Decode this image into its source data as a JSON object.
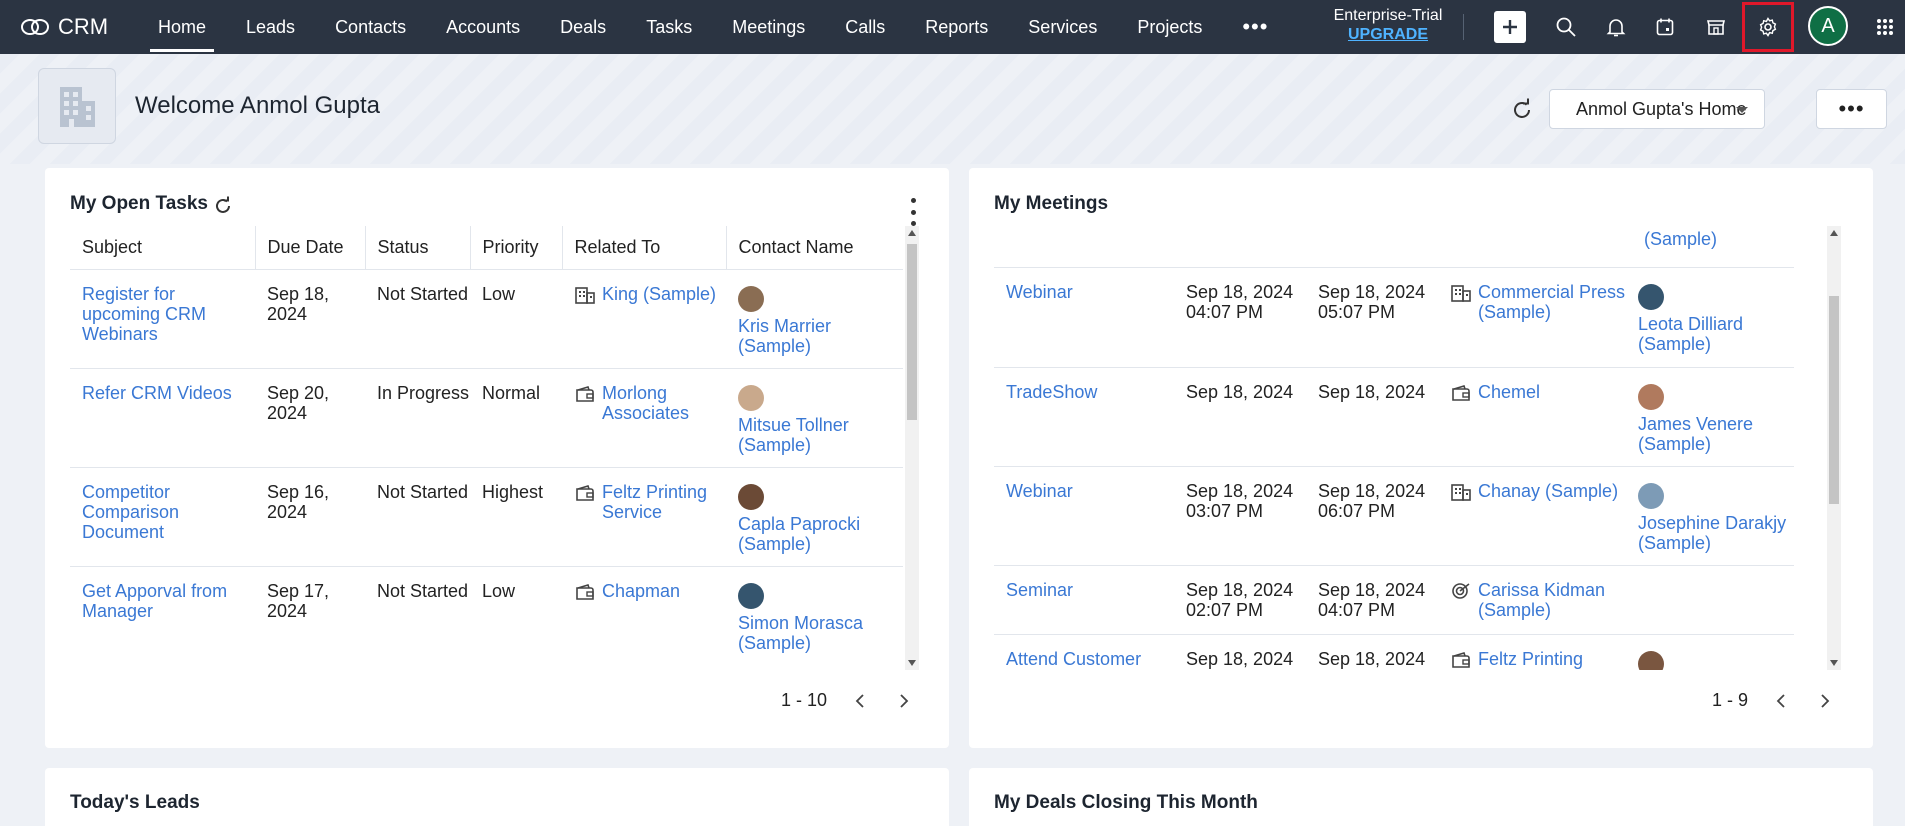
{
  "app": {
    "logo_text": "CRM"
  },
  "nav": {
    "items": [
      "Home",
      "Leads",
      "Contacts",
      "Accounts",
      "Deals",
      "Tasks",
      "Meetings",
      "Calls",
      "Reports",
      "Services",
      "Projects"
    ],
    "active": "Home",
    "more_label": "•••"
  },
  "trial": {
    "edition": "Enterprise-Trial",
    "upgrade": "UPGRADE"
  },
  "user": {
    "avatar_initial": "A"
  },
  "header": {
    "welcome": "Welcome Anmol Gupta",
    "home_select": "Anmol Gupta's Home",
    "more_label": "•••"
  },
  "tasks": {
    "title": "My Open Tasks",
    "columns": [
      "Subject",
      "Due Date",
      "Status",
      "Priority",
      "Related To",
      "Contact Name"
    ],
    "rows": [
      {
        "subject": "Register for upcoming CRM Webinars",
        "due": "Sep 18, 2024",
        "status": "Not Started",
        "priority": "Low",
        "related": "King (Sample)",
        "related_icon": "account-icon",
        "contact": "Kris Marrier (Sample)"
      },
      {
        "subject": "Refer CRM Videos",
        "due": "Sep 20, 2024",
        "status": "In Progress",
        "priority": "Normal",
        "related": "Morlong Associates",
        "related_icon": "deal-icon",
        "contact": "Mitsue Tollner (Sample)"
      },
      {
        "subject": "Competitor Comparison Document",
        "due": "Sep 16, 2024",
        "status": "Not Started",
        "priority": "Highest",
        "related": "Feltz Printing Service",
        "related_icon": "deal-icon",
        "contact": "Capla Paprocki (Sample)"
      },
      {
        "subject": "Get Apporval from Manager",
        "due": "Sep 17, 2024",
        "status": "Not Started",
        "priority": "Low",
        "related": "Chapman",
        "related_icon": "deal-icon",
        "contact": "Simon Morasca (Sample)"
      }
    ],
    "pager": "1 - 10"
  },
  "meetings": {
    "title": "My Meetings",
    "top_partial": "(Sample)",
    "rows": [
      {
        "title": "Webinar",
        "from": "Sep 18, 2024 04:07 PM",
        "to": "Sep 18, 2024 05:07 PM",
        "related": "Commercial Press (Sample)",
        "related_icon": "account-icon",
        "contact": "Leota Dilliard (Sample)"
      },
      {
        "title": "TradeShow",
        "from": "Sep 18, 2024",
        "to": "Sep 18, 2024",
        "related": "Chemel",
        "related_icon": "deal-icon",
        "contact": "James Venere (Sample)"
      },
      {
        "title": "Webinar",
        "from": "Sep 18, 2024 03:07 PM",
        "to": "Sep 18, 2024 06:07 PM",
        "related": "Chanay (Sample)",
        "related_icon": "account-icon",
        "contact": "Josephine Darakjy (Sample)"
      },
      {
        "title": "Seminar",
        "from": "Sep 18, 2024 02:07 PM",
        "to": "Sep 18, 2024 04:07 PM",
        "related": "Carissa Kidman (Sample)",
        "related_icon": "lead-icon",
        "contact": ""
      },
      {
        "title": "Attend Customer conference",
        "from": "Sep 18, 2024",
        "to": "Sep 18, 2024",
        "related": "Feltz Printing Service",
        "related_icon": "deal-icon",
        "contact": ""
      }
    ],
    "pager": "1 - 9"
  },
  "leads_card": {
    "title": "Today's Leads"
  },
  "deals_card": {
    "title": "My Deals Closing This Month"
  },
  "colors": {
    "nav_bg": "#2b3442",
    "link": "#3a78d4",
    "highlight": "#e0182a",
    "avatar_bg": "#0f6f45"
  }
}
